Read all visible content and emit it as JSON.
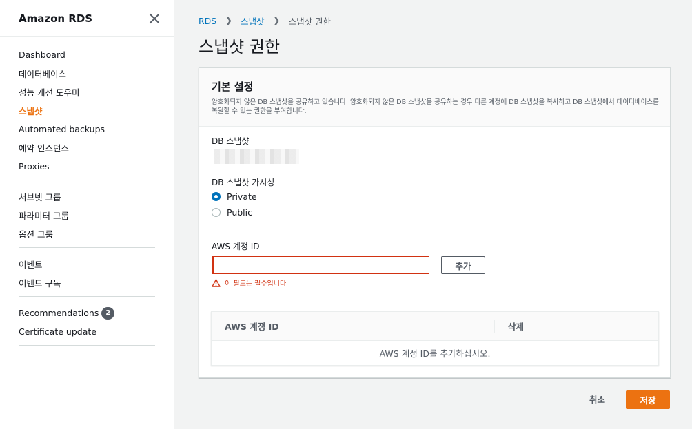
{
  "sidebar": {
    "title": "Amazon RDS",
    "group1": [
      "Dashboard",
      "데이터베이스",
      "성능 개선 도우미",
      "스냅샷",
      "Automated backups",
      "예약 인스턴스",
      "Proxies"
    ],
    "group2": [
      "서브넷 그룹",
      "파라미터 그룹",
      "옵션 그룹"
    ],
    "group3": [
      "이벤트",
      "이벤트 구독"
    ],
    "group4": {
      "recommendations": "Recommendations",
      "recommendations_count": "2",
      "certificate": "Certificate update"
    }
  },
  "breadcrumb": [
    "RDS",
    "스냅샷",
    "스냅샷 권한"
  ],
  "page_title": "스냅샷 권한",
  "panel": {
    "title": "기본 설정",
    "description": "암호화되지 않은 DB 스냅샷을 공유하고 있습니다. 암호화되지 않은 DB 스냅샷을 공유하는 경우 다른 계정에 DB 스냅샷을 복사하고 DB 스냅샷에서 데이터베이스를 복원할 수 있는 권한을 부여합니다.",
    "snapshot_label": "DB 스냅샷",
    "visibility_label": "DB 스냅샷 가시성",
    "radio_private": "Private",
    "radio_public": "Public",
    "account_label": "AWS 계정 ID",
    "account_value": "",
    "add_button": "추가",
    "error_text": "이 필드는 필수입니다",
    "table": {
      "col_id": "AWS 계정 ID",
      "col_delete": "삭제",
      "empty": "AWS 계정 ID를 추가하십시오."
    }
  },
  "footer": {
    "cancel": "취소",
    "save": "저장"
  },
  "colors": {
    "accent": "#ec7211",
    "link": "#0073bb",
    "error": "#d13212"
  }
}
